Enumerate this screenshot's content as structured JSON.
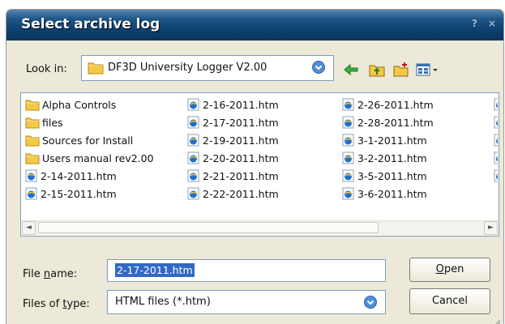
{
  "dialog": {
    "title": "Select archive log",
    "help_glyph": "?",
    "close_glyph": "×"
  },
  "look_in": {
    "label": "Look in:",
    "value": "DF3D University Logger V2.00"
  },
  "toolbar": {
    "back_icon": "back-arrow-icon",
    "up_icon": "up-folder-icon",
    "new_folder_icon": "new-folder-icon",
    "view_menu_icon": "view-menu-icon"
  },
  "files": [
    {
      "name": "Alpha Controls",
      "type": "folder"
    },
    {
      "name": "files",
      "type": "folder"
    },
    {
      "name": "Sources for Install",
      "type": "folder"
    },
    {
      "name": "Users manual rev2.00",
      "type": "folder"
    },
    {
      "name": "2-14-2011.htm",
      "type": "htm"
    },
    {
      "name": "2-15-2011.htm",
      "type": "htm"
    },
    {
      "name": "2-16-2011.htm",
      "type": "htm"
    },
    {
      "name": "2-17-2011.htm",
      "type": "htm"
    },
    {
      "name": "2-19-2011.htm",
      "type": "htm"
    },
    {
      "name": "2-20-2011.htm",
      "type": "htm"
    },
    {
      "name": "2-21-2011.htm",
      "type": "htm"
    },
    {
      "name": "2-22-2011.htm",
      "type": "htm"
    },
    {
      "name": "2-26-2011.htm",
      "type": "htm"
    },
    {
      "name": "2-28-2011.htm",
      "type": "htm"
    },
    {
      "name": "3-1-2011.htm",
      "type": "htm"
    },
    {
      "name": "3-2-2011.htm",
      "type": "htm"
    },
    {
      "name": "3-5-2011.htm",
      "type": "htm"
    },
    {
      "name": "3-6-2011.htm",
      "type": "htm"
    }
  ],
  "file_name": {
    "label_pre": "File ",
    "label_accel": "n",
    "label_post": "ame:",
    "value": "2-17-2011.htm"
  },
  "file_type": {
    "label_pre": "Files of ",
    "label_accel": "t",
    "label_post": "ype:",
    "value": "HTML files (*.htm)"
  },
  "buttons": {
    "open_accel": "O",
    "open_rest": "pen",
    "cancel": "Cancel"
  },
  "colors": {
    "title_bar": "#0b3f6d",
    "selection": "#316ac5",
    "dialog_bg": "#ece9d8"
  }
}
